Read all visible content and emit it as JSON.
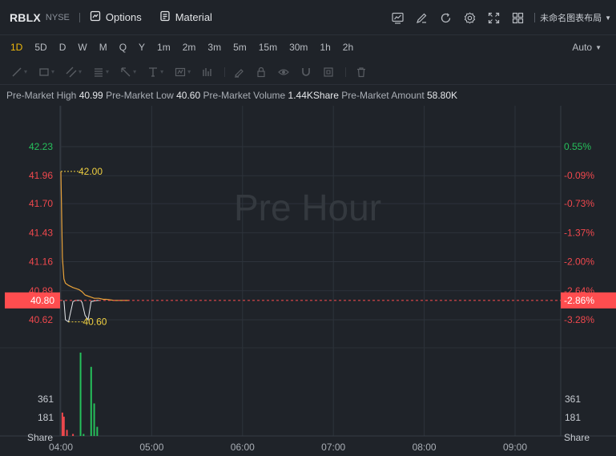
{
  "header": {
    "symbol": "RBLX",
    "exchange": "NYSE",
    "options_label": "Options",
    "material_label": "Material",
    "layout_name": "未命名图表布局"
  },
  "intervals": [
    "1D",
    "5D",
    "D",
    "W",
    "M",
    "Q",
    "Y",
    "1m",
    "2m",
    "3m",
    "5m",
    "15m",
    "30m",
    "1h",
    "2h"
  ],
  "active_interval": "1D",
  "scale_mode": "Auto",
  "stats": {
    "high_label": "Pre-Market High",
    "high_value": "40.99",
    "low_label": "Pre-Market Low",
    "low_value": "40.60",
    "volume_label": "Pre-Market Volume",
    "volume_value": "1.44KShare",
    "amount_label": "Pre-Market Amount",
    "amount_value": "58.80K"
  },
  "watermark": "Pre Hour",
  "colors": {
    "up": "#26c05b",
    "down": "#f0484d",
    "price_line": "#e8a23a",
    "current": "#ff4d4f",
    "label_yellow": "#f0d041"
  },
  "chart_data": {
    "type": "line",
    "price_axis_left": [
      "42.23",
      "41.96",
      "41.70",
      "41.43",
      "41.16",
      "40.89",
      "40.62"
    ],
    "price_axis_values": [
      42.23,
      41.96,
      41.7,
      41.43,
      41.16,
      40.89,
      40.62
    ],
    "pct_axis_right": [
      "0.55%",
      "-0.09%",
      "-0.73%",
      "-1.37%",
      "-2.00%",
      "-2.64%",
      "-3.28%"
    ],
    "current_price": "40.80",
    "current_pct": "-2.86%",
    "high_marker": "42.00",
    "low_marker": "40.60",
    "volume_axis": [
      "361",
      "181"
    ],
    "volume_unit": "Share",
    "time_axis": [
      "04:00",
      "05:00",
      "06:00",
      "07:00",
      "08:00",
      "09:00"
    ],
    "price_series": {
      "x_minutes": [
        0,
        1,
        2,
        3,
        5,
        8,
        10,
        12,
        14,
        16,
        18,
        20,
        22,
        25,
        28,
        30,
        35,
        40,
        45
      ],
      "y": [
        42.0,
        41.2,
        41.0,
        40.96,
        40.94,
        40.92,
        40.91,
        40.9,
        40.88,
        40.85,
        40.84,
        40.83,
        40.82,
        40.82,
        40.81,
        40.81,
        40.8,
        40.8,
        40.8
      ]
    },
    "avg_series": {
      "x_minutes": [
        2,
        3,
        5,
        8,
        10,
        12,
        13,
        14,
        16,
        18,
        20,
        24,
        26
      ],
      "y": [
        40.8,
        40.62,
        40.6,
        40.79,
        40.8,
        40.8,
        40.8,
        40.78,
        40.66,
        40.62,
        40.79,
        40.8,
        40.8
      ]
    },
    "volume_bars": [
      {
        "min": 1,
        "v": 230,
        "up": false
      },
      {
        "min": 2,
        "v": 190,
        "up": false
      },
      {
        "min": 4,
        "v": 60,
        "up": false
      },
      {
        "min": 8,
        "v": 20,
        "up": false
      },
      {
        "min": 13,
        "v": 820,
        "up": true
      },
      {
        "min": 15,
        "v": 20,
        "up": true
      },
      {
        "min": 20,
        "v": 680,
        "up": true
      },
      {
        "min": 22,
        "v": 320,
        "up": true
      },
      {
        "min": 24,
        "v": 90,
        "up": true
      }
    ]
  }
}
